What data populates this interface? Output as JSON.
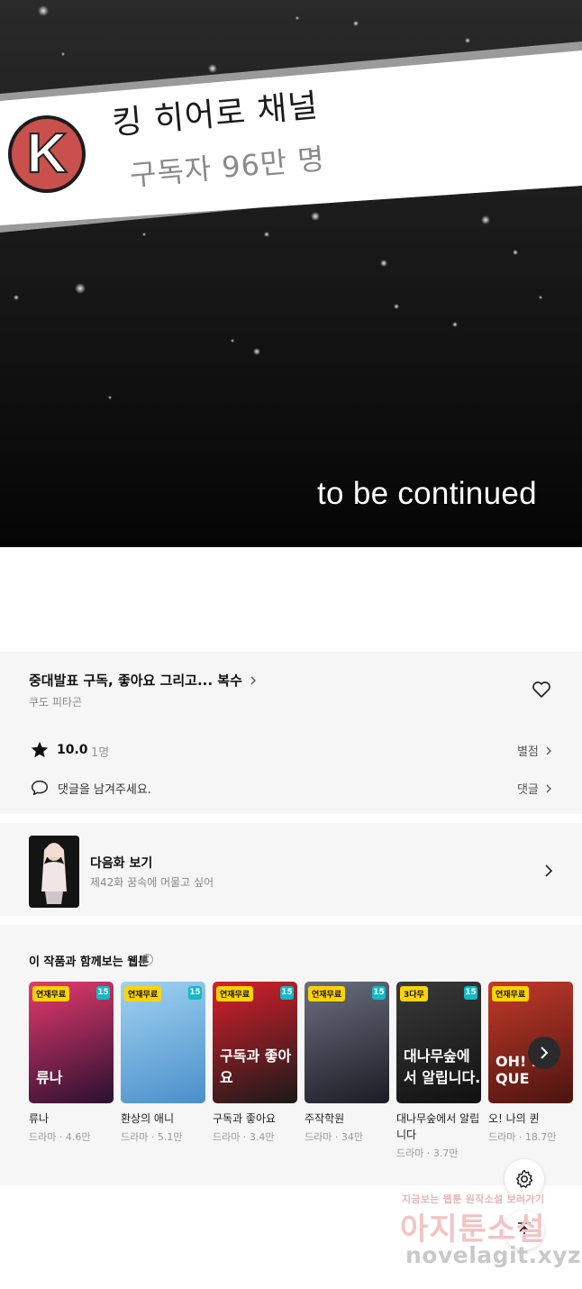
{
  "panel": {
    "banner_title": "킹 히어로 채널",
    "banner_subtitle": "구독자 96만 명",
    "logo_letter": "K",
    "caption": "to be continued"
  },
  "episode": {
    "title": "중대발표 구독, 좋아요 그리고... 복수",
    "author": "쿠도 피타곤",
    "rating": "10.0",
    "rating_count": "1명",
    "rate_link": "별점",
    "comment_placeholder": "댓글을 남겨주세요.",
    "comment_link": "댓글"
  },
  "next_episode": {
    "label": "다음화 보기",
    "subtitle": "제42화 꿈속에 머물고 싶어"
  },
  "recommendations": {
    "title": "이 작품과 함께보는 웹툰",
    "help": "?",
    "items": [
      {
        "name": "류나",
        "meta": "드라마 · 4.6만",
        "badge": "연재무료",
        "age": "15",
        "cover_text": "류나",
        "color_a": "#e63a6e",
        "color_b": "#2a1030"
      },
      {
        "name": "환상의 애니",
        "meta": "드라마 · 5.1만",
        "badge": "연재무료",
        "age": "15",
        "cover_text": "",
        "color_a": "#9fd2f2",
        "color_b": "#4a8fc9"
      },
      {
        "name": "구독과 좋아요",
        "meta": "드라마 · 3.4만",
        "badge": "연재무료",
        "age": "15",
        "cover_text": "구독과 좋아요",
        "color_a": "#d8202c",
        "color_b": "#1a1a1a"
      },
      {
        "name": "주작학원",
        "meta": "드라마 · 34만",
        "badge": "연재무료",
        "age": "15",
        "cover_text": "",
        "color_a": "#6b6f80",
        "color_b": "#1c1c24"
      },
      {
        "name": "대나무숲에서 알립니다",
        "meta": "드라마 · 3.7만",
        "badge": "3다무",
        "age": "15",
        "cover_text": "대나무숲에서 알립니다.",
        "color_a": "#3a3a3a",
        "color_b": "#111111"
      },
      {
        "name": "오! 나의 퀸",
        "meta": "드라마 · 18.7만",
        "badge": "연재무료",
        "age": "",
        "cover_text": "OH! MY QUE",
        "color_a": "#c43a2a",
        "color_b": "#4b1410"
      }
    ]
  },
  "watermark": {
    "line1": "지금보는 웹툰 원작소설 보러가기",
    "line2": "아지툰소설",
    "line3": "novelagit.xyz"
  },
  "colors": {
    "banner_bg": "#ffffff",
    "panel_bg": "#0c0c0c",
    "logo_red": "#c9504d",
    "age_teal": "#15b8c6",
    "badge_yellow": "#ffd400"
  },
  "icons": [
    "heart-icon",
    "star-icon",
    "comment-icon",
    "chevron-right-icon",
    "help-icon",
    "settings-icon",
    "scroll-top-icon"
  ]
}
